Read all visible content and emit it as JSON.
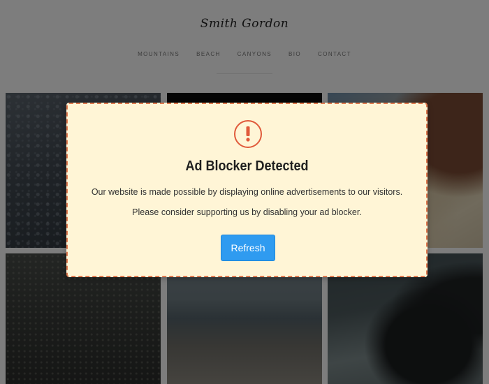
{
  "site": {
    "logo": "Smith Gordon",
    "nav": [
      "MOUNTAINS",
      "BEACH",
      "CANYONS",
      "BIO",
      "CONTACT"
    ]
  },
  "modal": {
    "icon": "exclamation-circle-icon",
    "title": "Ad Blocker Detected",
    "body": "Our website is made possible by displaying online advertisements to our visitors. Please consider supporting us by disabling your ad blocker.",
    "button_label": "Refresh"
  },
  "colors": {
    "modal_background": "#fff5d6",
    "modal_border": "#e07a4f",
    "icon": "#e0593a",
    "button": "#2f9bf0"
  }
}
